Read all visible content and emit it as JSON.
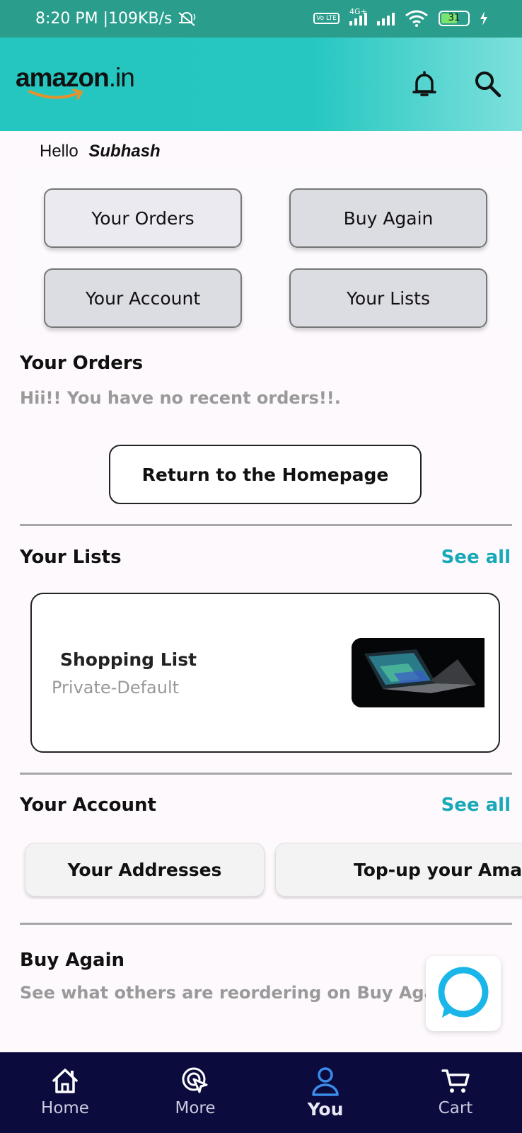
{
  "status_bar": {
    "time": "8:20 PM",
    "speed": "109KB/s",
    "volte_label": "Vo LTE",
    "network_label": "4G+",
    "battery_level": "31"
  },
  "header": {
    "logo_main": "amazon",
    "logo_suffix": ".in",
    "icons": [
      "bell-icon",
      "search-icon"
    ]
  },
  "greeting": {
    "prefix": "Hello",
    "name": "Subhash"
  },
  "quick_buttons": [
    {
      "label": "Your Orders"
    },
    {
      "label": "Buy Again"
    },
    {
      "label": "Your Account"
    },
    {
      "label": "Your Lists"
    }
  ],
  "orders_section": {
    "title": "Your Orders",
    "message": "Hii!! You have no recent orders!!.",
    "button_label": "Return to the Homepage"
  },
  "lists_section": {
    "title": "Your Lists",
    "see_all": "See all",
    "card": {
      "name": "Shopping List",
      "subtitle": "Private-Default"
    }
  },
  "account_section": {
    "title": "Your Account",
    "see_all": "See all",
    "chips": [
      {
        "label": "Your Addresses"
      },
      {
        "label": "Top-up your Amazon Pay"
      }
    ]
  },
  "buy_again_section": {
    "title": "Buy Again",
    "message": "See what others are reordering on Buy Again"
  },
  "bottom_nav": [
    {
      "label": "Home",
      "icon": "home-icon"
    },
    {
      "label": "More",
      "icon": "more-icon"
    },
    {
      "label": "You",
      "icon": "user-icon"
    },
    {
      "label": "Cart",
      "icon": "cart-icon"
    }
  ],
  "colors": {
    "accent": "#17a9b8",
    "header": "#25c6c0",
    "nav_bg": "#0b0b3e",
    "alexa": "#1ab6e8"
  }
}
